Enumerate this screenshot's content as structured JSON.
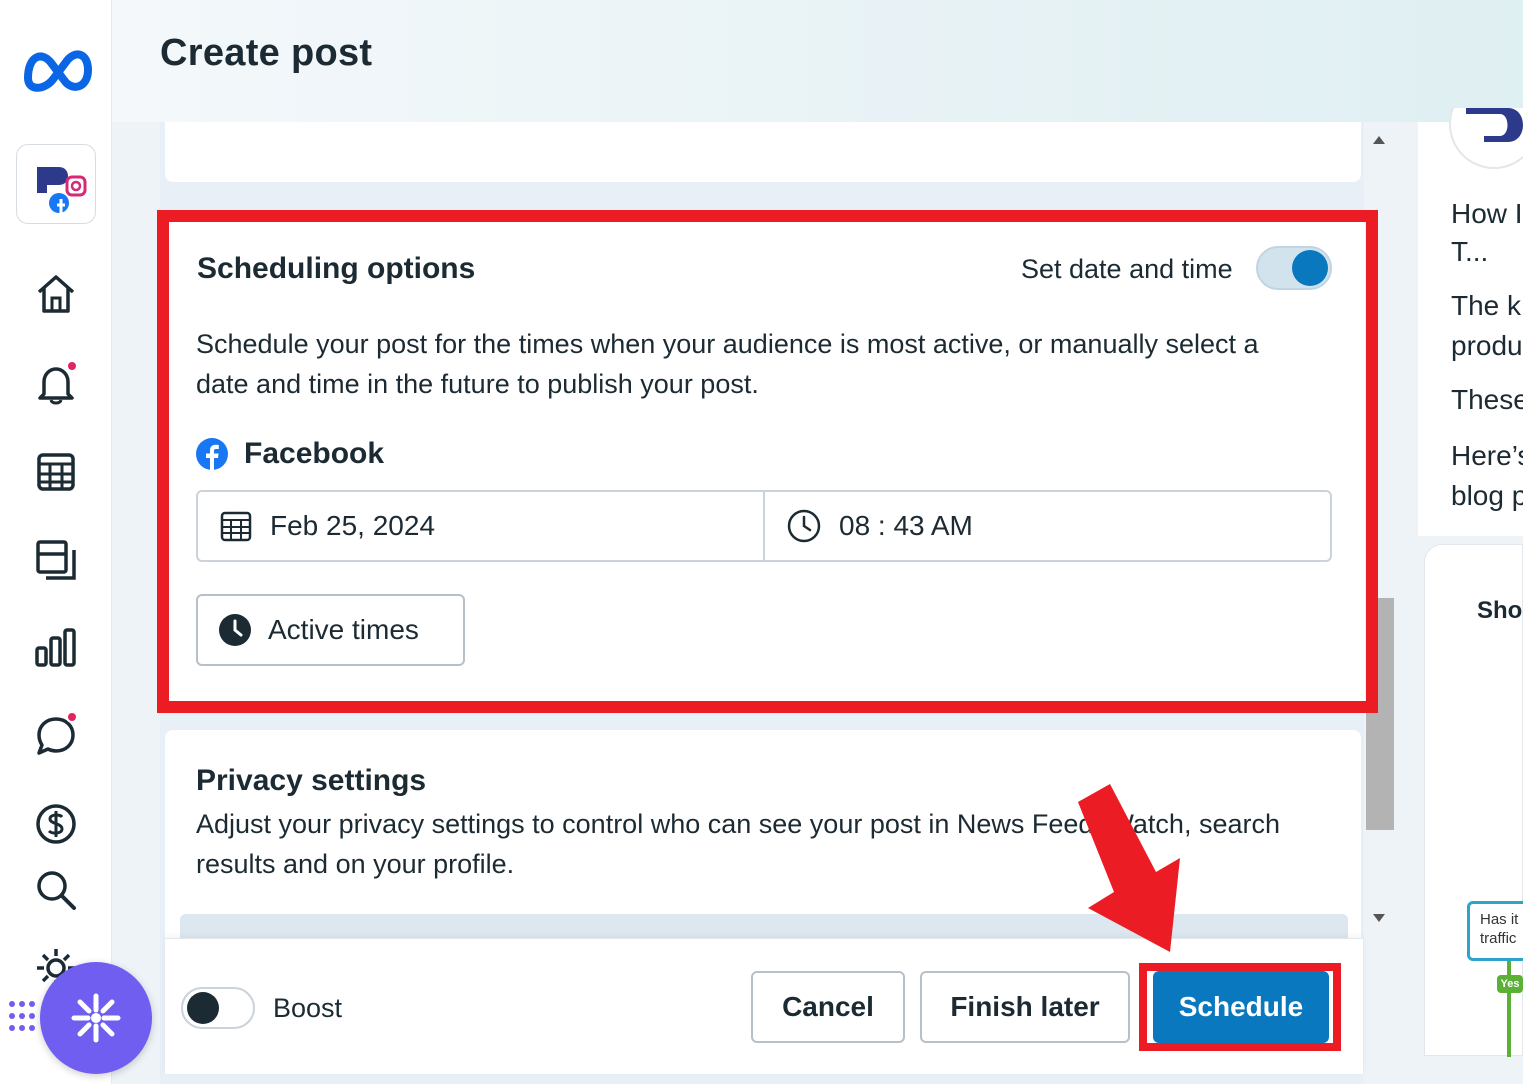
{
  "header": {
    "title": "Create post"
  },
  "rail": {
    "icons": [
      "meta-logo-icon",
      "account-avatar-icon",
      "home-icon",
      "notifications-bell-icon",
      "calendar-grid-icon",
      "content-pages-icon",
      "insights-bar-chart-icon",
      "messages-chat-icon",
      "monetization-dollar-icon",
      "search-icon",
      "settings-gear-icon"
    ],
    "notification_dot_color": "#e0245e"
  },
  "scheduling": {
    "title": "Scheduling options",
    "toggle_label": "Set date and time",
    "toggle_on": true,
    "description": "Schedule your post for the times when your audience is most active, or manually select a date and time in the future to publish your post.",
    "platform": "Facebook",
    "date": "Feb 25, 2024",
    "time": "08 : 43 AM",
    "active_times_label": "Active times"
  },
  "privacy": {
    "title": "Privacy settings",
    "description": "Adjust your privacy settings to control who can see your post in News Feed, Watch, search results and on your profile."
  },
  "footer": {
    "boost_label": "Boost",
    "boost_on": false,
    "cancel_label": "Cancel",
    "finish_later_label": "Finish later",
    "schedule_label": "Schedule"
  },
  "right_panel": {
    "lines": [
      "How I",
      "T...",
      "The k",
      "produ",
      "These",
      "Here’s",
      "blog p"
    ],
    "card_title": "Sho",
    "flow_text_1": "Has it",
    "flow_text_2": "traffic",
    "flow_yes": "Yes"
  },
  "colors": {
    "accent": "#0a78be",
    "highlight": "#ec1c24",
    "fab": "#6f5ef0"
  }
}
